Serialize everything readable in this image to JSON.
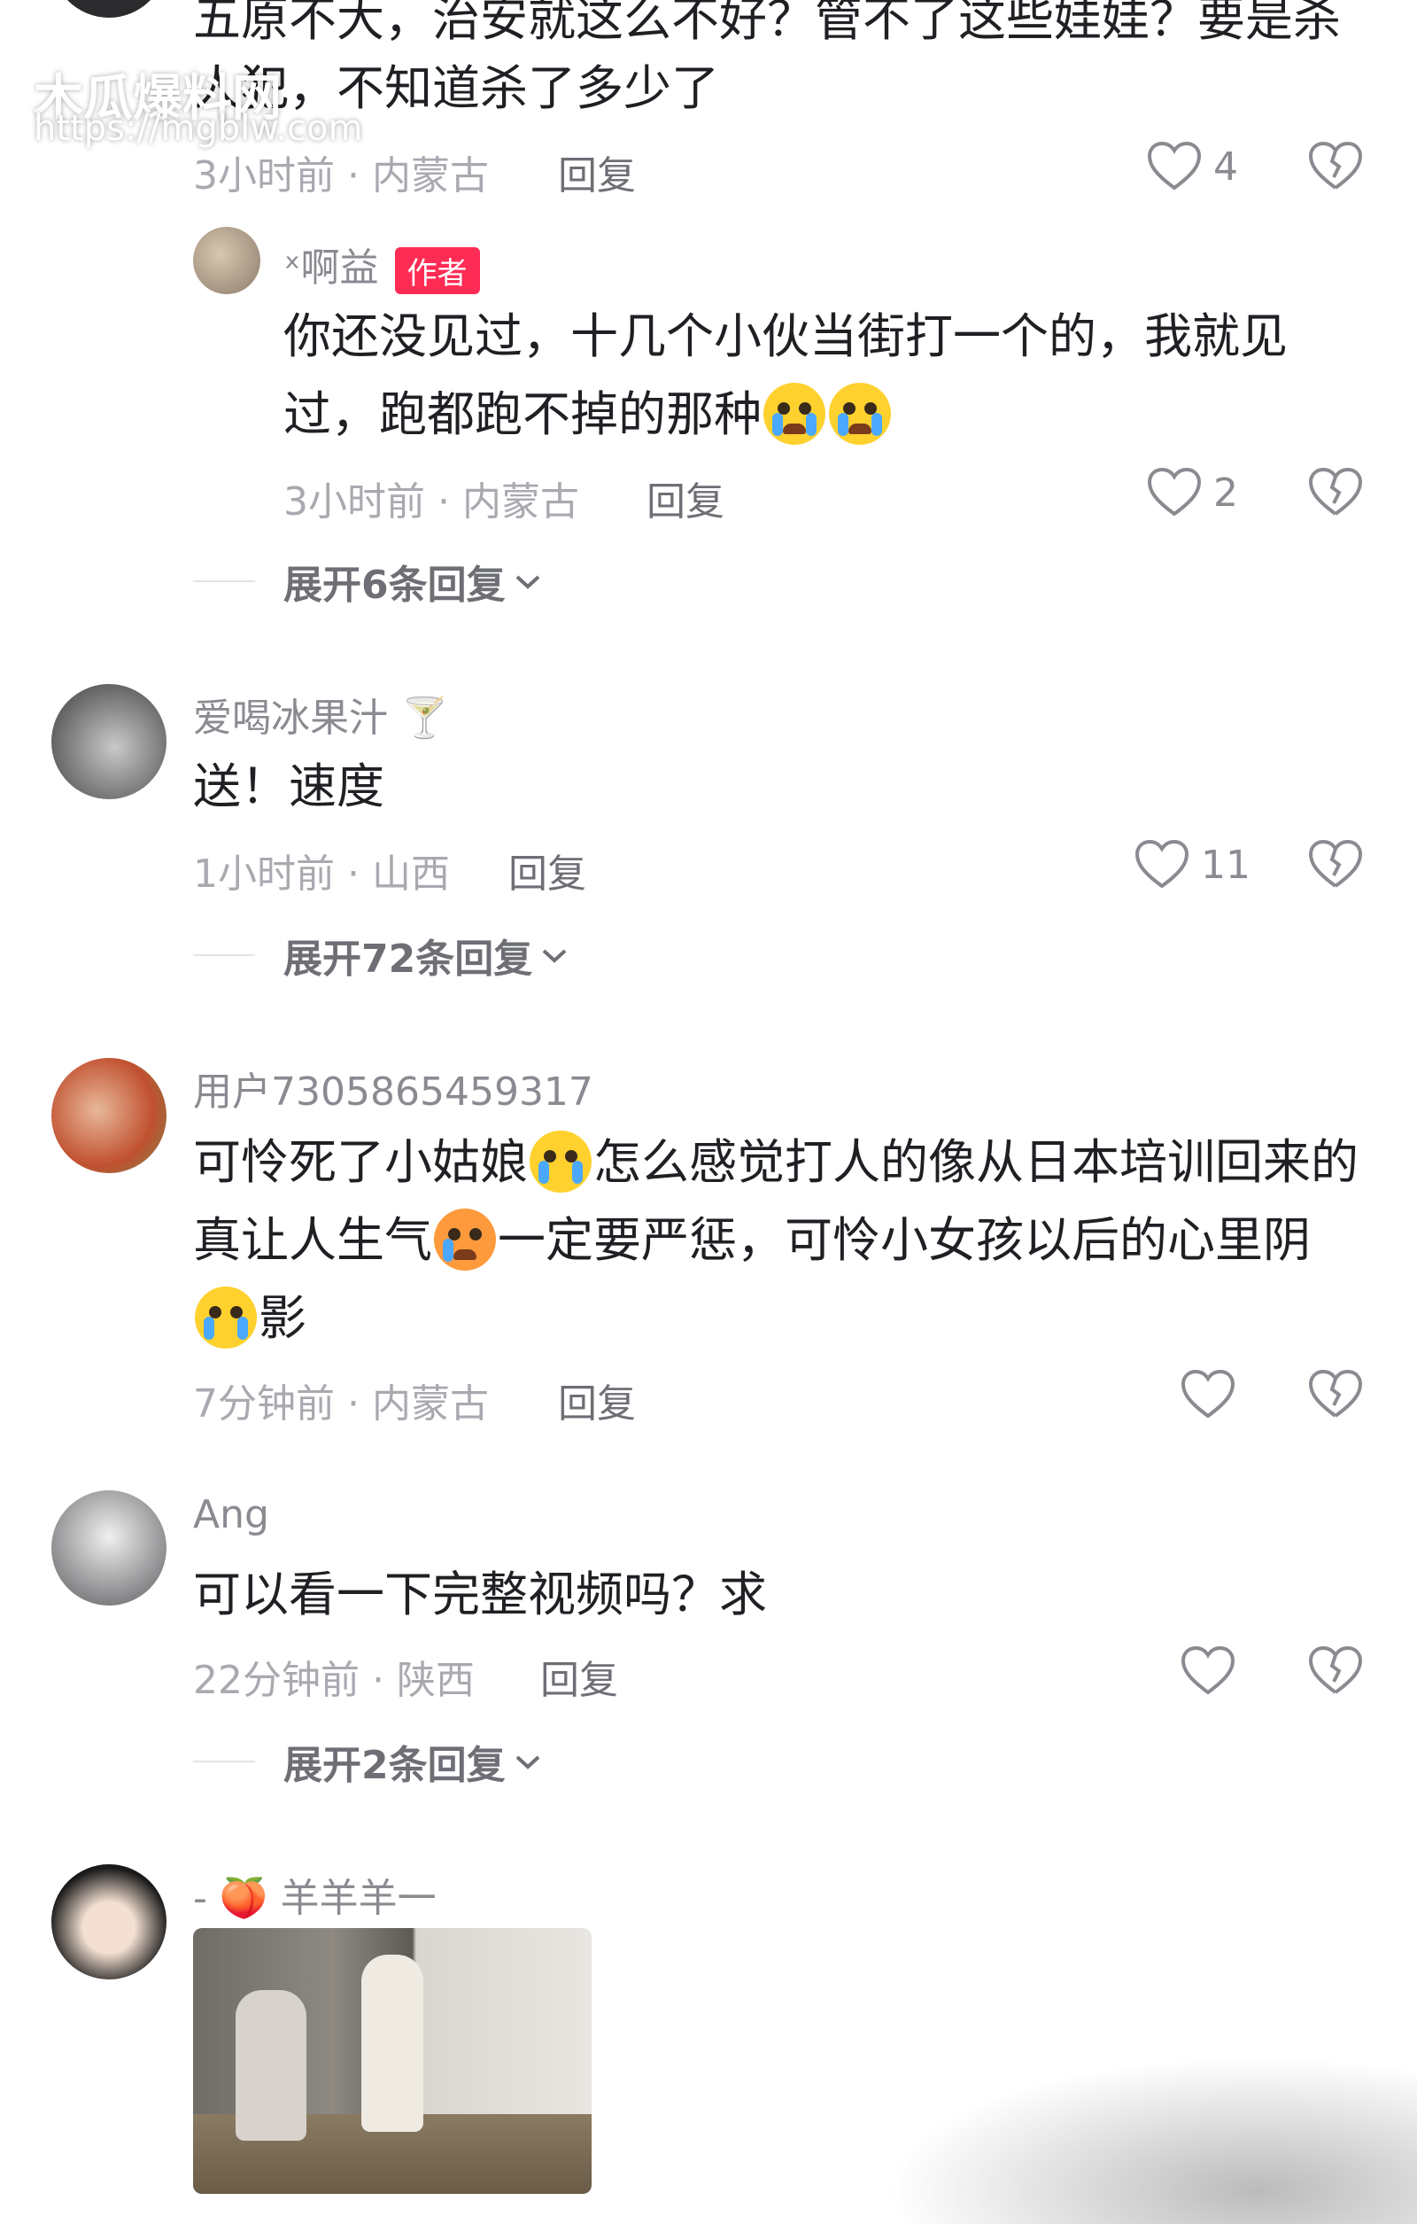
{
  "watermark": {
    "title": "木瓜爆料网",
    "url": "https://mgblw.com"
  },
  "comments": [
    {
      "text_lines": [
        "五原不大，治安就这么不好？管不了这些娃娃？要是杀",
        "人犯，不知道杀了多少了"
      ],
      "meta": "3小时前 · 内蒙古",
      "reply_label": "回复",
      "likes": "4"
    },
    {
      "username": "ˣ啊益",
      "badge": "作者",
      "text_lines": [
        "你还没见过，十几个小伙当街打一个的，我就见",
        "过，跑都跑不掉的那种"
      ],
      "meta": "3小时前 · 内蒙古",
      "reply_label": "回复",
      "likes": "2",
      "expand": "展开6条回复"
    },
    {
      "username": "爱喝冰果汁 🍸",
      "text_lines": [
        "送！速度"
      ],
      "meta": "1小时前 · 山西",
      "reply_label": "回复",
      "likes": "11",
      "expand": "展开72条回复"
    },
    {
      "username": "用户7305865459317",
      "text_lines": [
        "可怜死了小姑娘",
        "怎么感觉打人的像从日本培训回来的",
        "真让人生气",
        "一定要严惩，可怜小女孩以后的心里阴",
        "影"
      ],
      "meta": "7分钟前 · 内蒙古",
      "reply_label": "回复",
      "likes": ""
    },
    {
      "username": "Ang",
      "text_lines": [
        "可以看一下完整视频吗？求"
      ],
      "meta": "22分钟前 · 陕西",
      "reply_label": "回复",
      "likes": "",
      "expand": "展开2条回复"
    },
    {
      "username": "- 🍑 羊羊羊一"
    }
  ],
  "colors": {
    "author_badge": "#fe2c55",
    "heart_stroke": "#8a8b91"
  },
  "icons": [
    "heart-icon",
    "broken-heart-icon",
    "chevron-down-icon"
  ]
}
